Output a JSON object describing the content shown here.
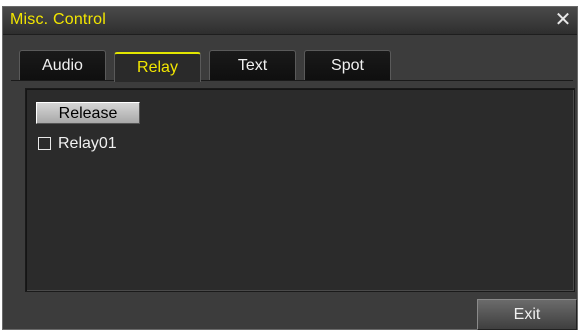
{
  "window": {
    "title": "Misc. Control",
    "close_glyph": "✕"
  },
  "tabs": [
    {
      "label": "Audio",
      "active": false
    },
    {
      "label": "Relay",
      "active": true
    },
    {
      "label": "Text",
      "active": false
    },
    {
      "label": "Spot",
      "active": false
    }
  ],
  "relay_panel": {
    "release_label": "Release",
    "relays": [
      {
        "label": "Relay01",
        "checked": false
      }
    ]
  },
  "footer": {
    "exit_label": "Exit"
  },
  "colors": {
    "title_text": "#f2e600",
    "active_tab_text": "#f2e600",
    "window_bg": "#3c3c3c",
    "panel_bg": "#2b2b2b"
  }
}
